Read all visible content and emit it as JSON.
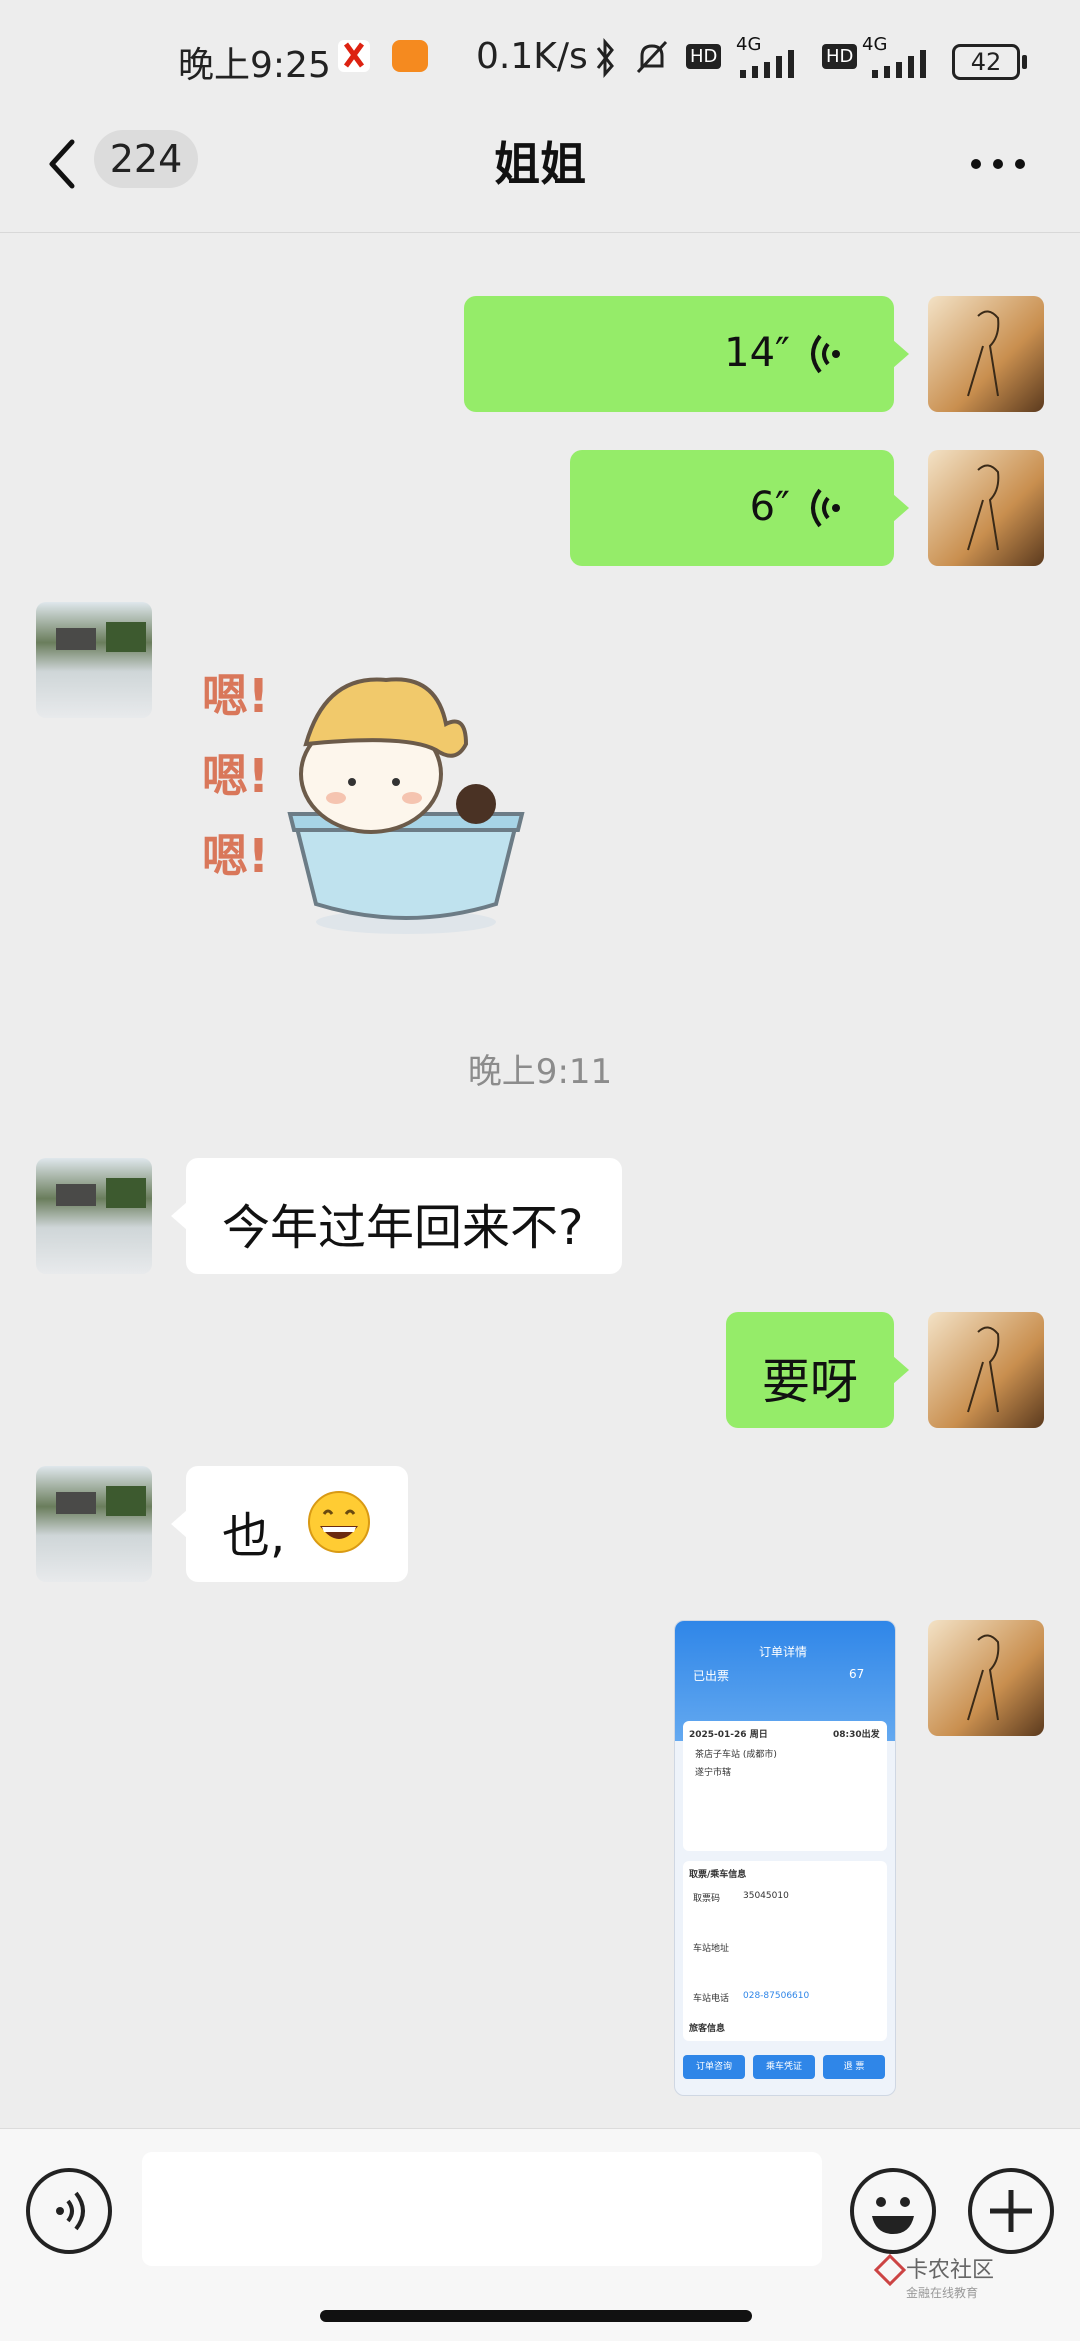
{
  "status_bar": {
    "time": "晚上9:25",
    "net_speed": "0.1K/s",
    "battery": "42",
    "sim1": "4G",
    "sim2": "4G",
    "hd1": "HD",
    "hd2": "HD"
  },
  "header": {
    "unread_count": "224",
    "contact_name": "姐姐"
  },
  "messages": [
    {
      "from": "me",
      "type": "voice",
      "duration": "14″"
    },
    {
      "from": "me",
      "type": "voice",
      "duration": "6″"
    },
    {
      "from": "her",
      "type": "sticker",
      "sticker_text": "嗯!"
    },
    {
      "type": "timestamp",
      "text": "晚上9:11"
    },
    {
      "from": "her",
      "type": "text",
      "text": "今年过年回来不?"
    },
    {
      "from": "me",
      "type": "text",
      "text": "要呀"
    },
    {
      "from": "her",
      "type": "text",
      "text": "也,",
      "emoji": "😄"
    },
    {
      "from": "me",
      "type": "image",
      "image": {
        "title": "订单详情",
        "status": "已出票",
        "price": "67",
        "date": "2025-01-26 周日",
        "depart_time": "08:30出发",
        "from_station": "茶店子车站 (成都市)",
        "to_station": "遂宁市辖",
        "section_ticket": "取票/乘车信息",
        "ticket_code_label": "取票码",
        "ticket_code": "35045010",
        "station_addr_label": "车站地址",
        "station_phone_label": "车站电话",
        "station_phone": "028-87506610",
        "passenger_label": "旅客信息",
        "btn1": "订单咨询",
        "btn2": "乘车凭证",
        "btn3": "退 票"
      }
    }
  ],
  "watermark": {
    "line1": "卡农社区",
    "line2": "金融在线教育"
  },
  "colors": {
    "green_bubble": "#95ec69",
    "background": "#ededed"
  }
}
